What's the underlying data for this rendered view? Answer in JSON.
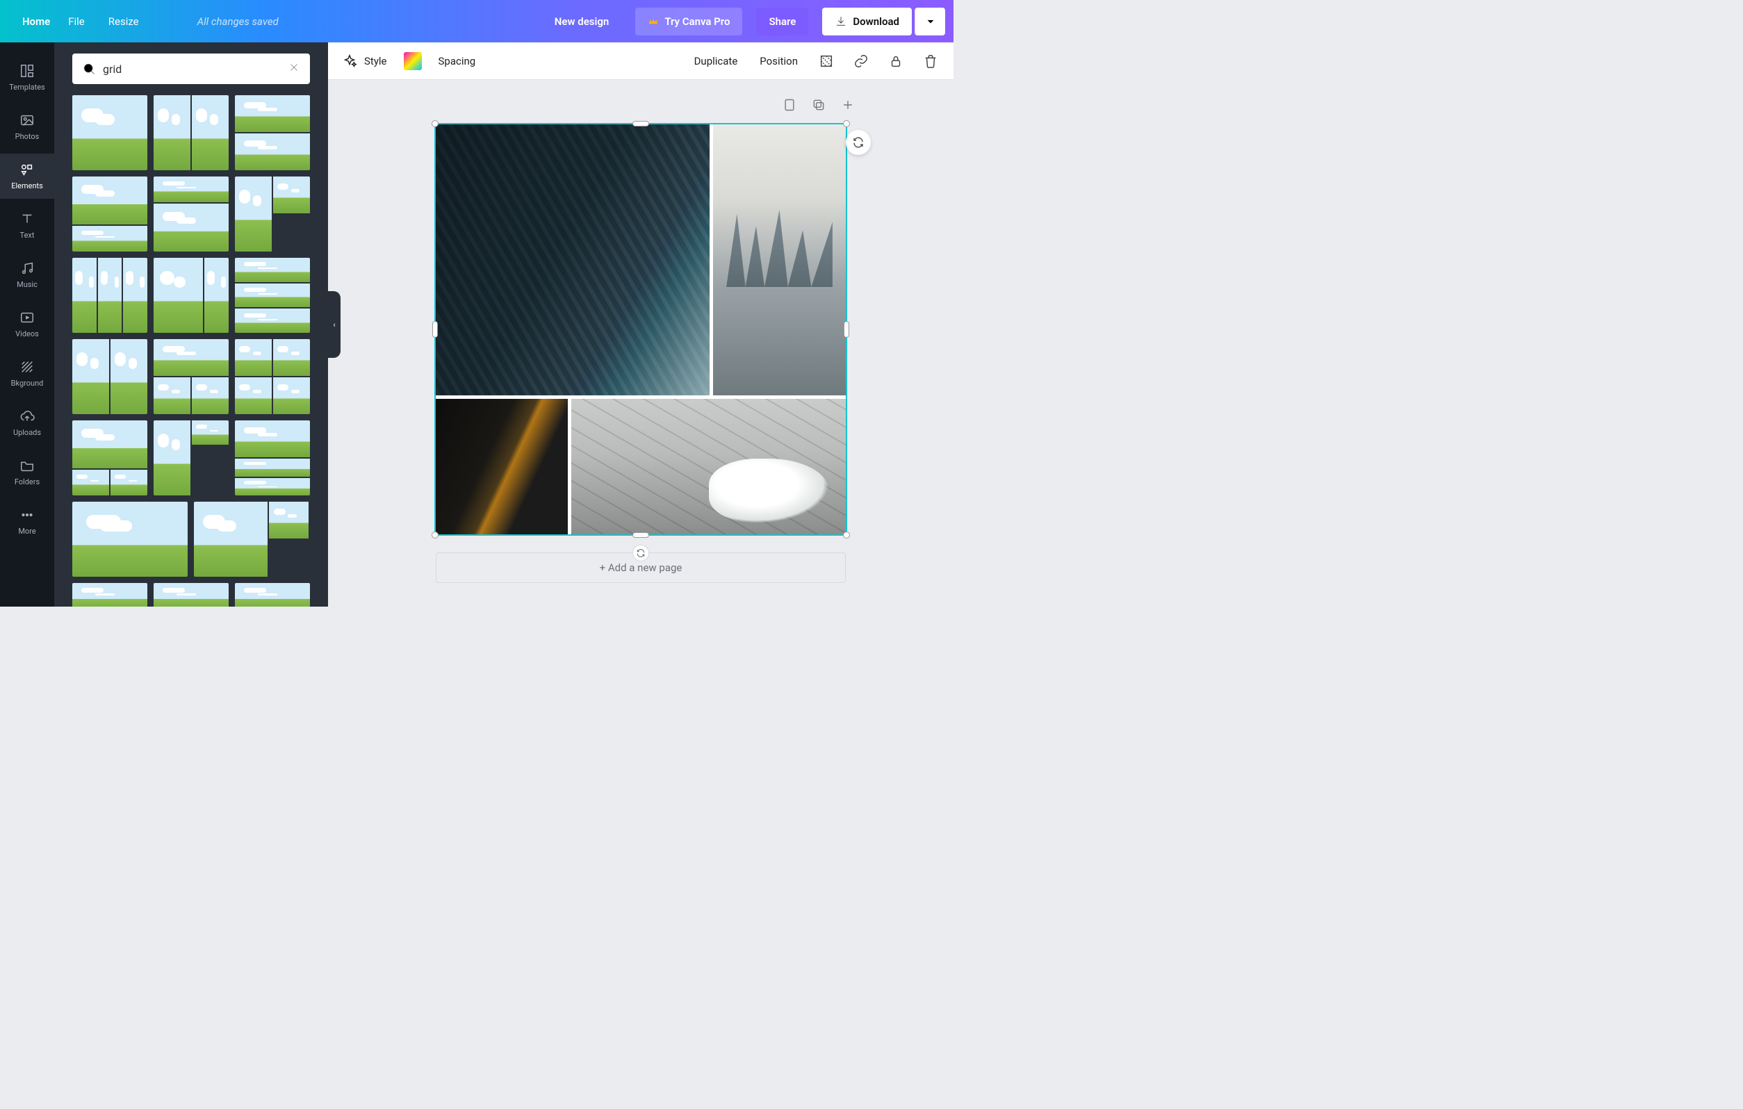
{
  "topbar": {
    "home": "Home",
    "file": "File",
    "resize": "Resize",
    "status": "All changes saved",
    "new_design": "New design",
    "try_pro": "Try Canva Pro",
    "share": "Share",
    "download": "Download"
  },
  "rail": {
    "items": [
      {
        "label": "Templates",
        "icon": "templates-icon"
      },
      {
        "label": "Photos",
        "icon": "photos-icon"
      },
      {
        "label": "Elements",
        "icon": "elements-icon",
        "active": true
      },
      {
        "label": "Text",
        "icon": "text-icon"
      },
      {
        "label": "Music",
        "icon": "music-icon"
      },
      {
        "label": "Videos",
        "icon": "videos-icon"
      },
      {
        "label": "Bkground",
        "icon": "background-icon"
      },
      {
        "label": "Uploads",
        "icon": "uploads-icon"
      },
      {
        "label": "Folders",
        "icon": "folders-icon"
      },
      {
        "label": "More",
        "icon": "more-icon"
      }
    ]
  },
  "search": {
    "value": "grid",
    "placeholder": "Search elements"
  },
  "toolbar": {
    "style": "Style",
    "spacing": "Spacing",
    "duplicate": "Duplicate",
    "position": "Position"
  },
  "canvas": {
    "add_page": "+ Add a new page"
  }
}
